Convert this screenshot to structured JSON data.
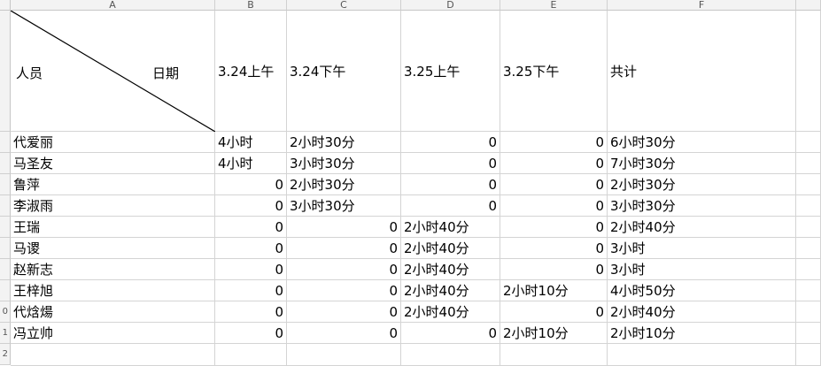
{
  "columns": [
    "A",
    "B",
    "C",
    "D",
    "E",
    "F"
  ],
  "row_numbers": [
    "",
    "",
    "",
    "",
    "",
    "",
    "",
    "",
    "",
    "0",
    "1",
    "2"
  ],
  "header": {
    "person_label": "人员",
    "date_label": "日期",
    "cols": [
      "3.24上午",
      "3.24下午",
      "3.25上午",
      "3.25下午",
      "共计"
    ]
  },
  "rows": [
    {
      "name": "代爱丽",
      "cells": [
        "4小时",
        "2小时30分",
        "0",
        "0",
        "6小时30分"
      ]
    },
    {
      "name": "马圣友",
      "cells": [
        "4小时",
        "3小时30分",
        "0",
        "0",
        "7小时30分"
      ]
    },
    {
      "name": "鲁萍",
      "cells": [
        "0",
        "2小时30分",
        "0",
        "0",
        "2小时30分"
      ]
    },
    {
      "name": "李淑雨",
      "cells": [
        "0",
        "3小时30分",
        "0",
        "0",
        "3小时30分"
      ]
    },
    {
      "name": "王瑞",
      "cells": [
        "0",
        "0",
        "2小时40分",
        "0",
        "2小时40分"
      ]
    },
    {
      "name": "马谡",
      "cells": [
        "0",
        "0",
        "2小时40分",
        "0",
        "3小时"
      ]
    },
    {
      "name": "赵新志",
      "cells": [
        "0",
        "0",
        "2小时40分",
        "0",
        "3小时"
      ]
    },
    {
      "name": "王梓旭",
      "cells": [
        "0",
        "0",
        "2小时40分",
        "2小时10分",
        "4小时50分"
      ]
    },
    {
      "name": "代焓煬",
      "cells": [
        "0",
        "0",
        "2小时40分",
        "0",
        "2小时40分"
      ]
    },
    {
      "name": "冯立帅",
      "cells": [
        "0",
        "0",
        "0",
        "2小时10分",
        "2小时10分"
      ]
    }
  ]
}
